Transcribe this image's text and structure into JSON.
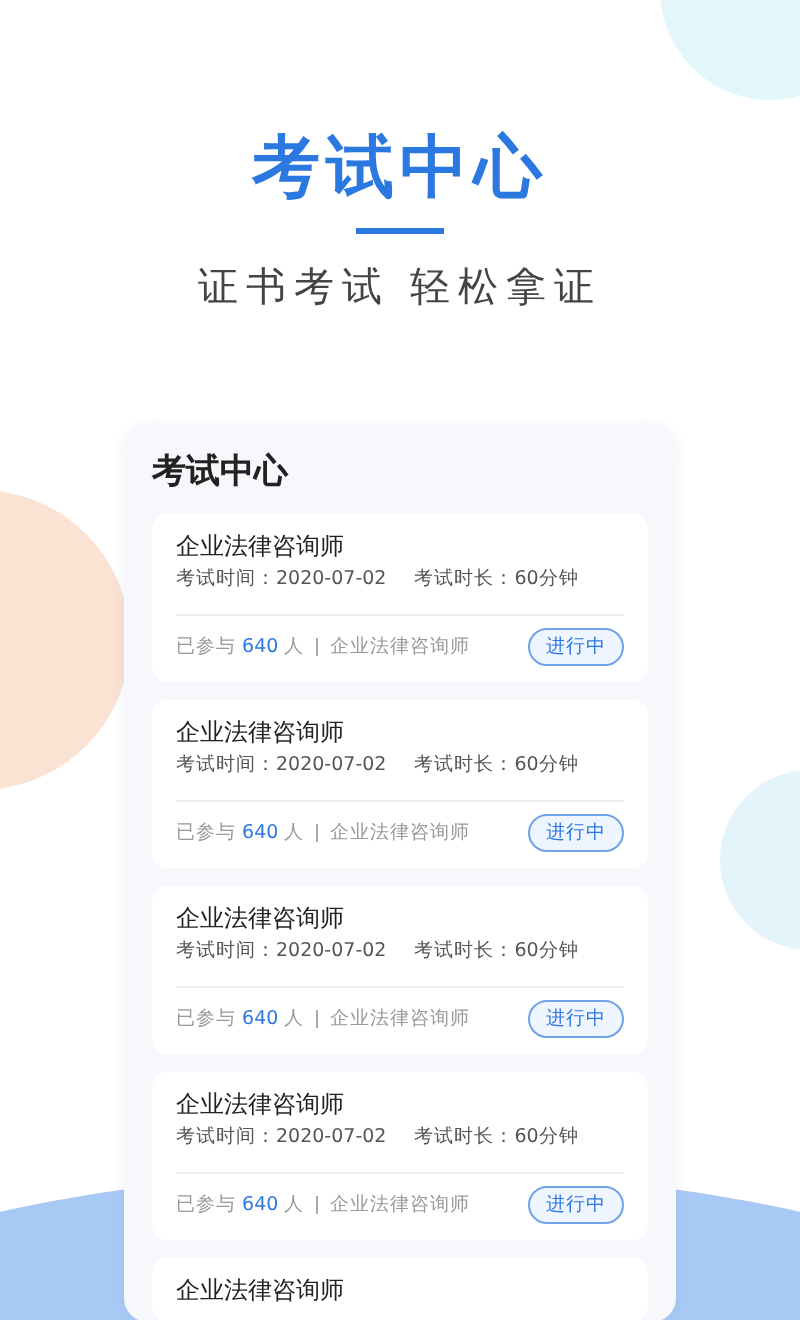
{
  "header": {
    "title": "考试中心",
    "subtitle": "证书考试 轻松拿证"
  },
  "panel": {
    "title": "考试中心",
    "exams": [
      {
        "name": "企业法律咨询师",
        "date_label": "考试时间：2020-07-02",
        "duration_label": "考试时长：60分钟",
        "joined_prefix": "已参与",
        "joined_count": "640",
        "joined_suffix": "人",
        "category": "企业法律咨询师",
        "status": "进行中"
      },
      {
        "name": "企业法律咨询师",
        "date_label": "考试时间：2020-07-02",
        "duration_label": "考试时长：60分钟",
        "joined_prefix": "已参与",
        "joined_count": "640",
        "joined_suffix": "人",
        "category": "企业法律咨询师",
        "status": "进行中"
      },
      {
        "name": "企业法律咨询师",
        "date_label": "考试时间：2020-07-02",
        "duration_label": "考试时长：60分钟",
        "joined_prefix": "已参与",
        "joined_count": "640",
        "joined_suffix": "人",
        "category": "企业法律咨询师",
        "status": "进行中"
      },
      {
        "name": "企业法律咨询师",
        "date_label": "考试时间：2020-07-02",
        "duration_label": "考试时长：60分钟",
        "joined_prefix": "已参与",
        "joined_count": "640",
        "joined_suffix": "人",
        "category": "企业法律咨询师",
        "status": "进行中"
      },
      {
        "name": "企业法律咨询师"
      }
    ]
  }
}
